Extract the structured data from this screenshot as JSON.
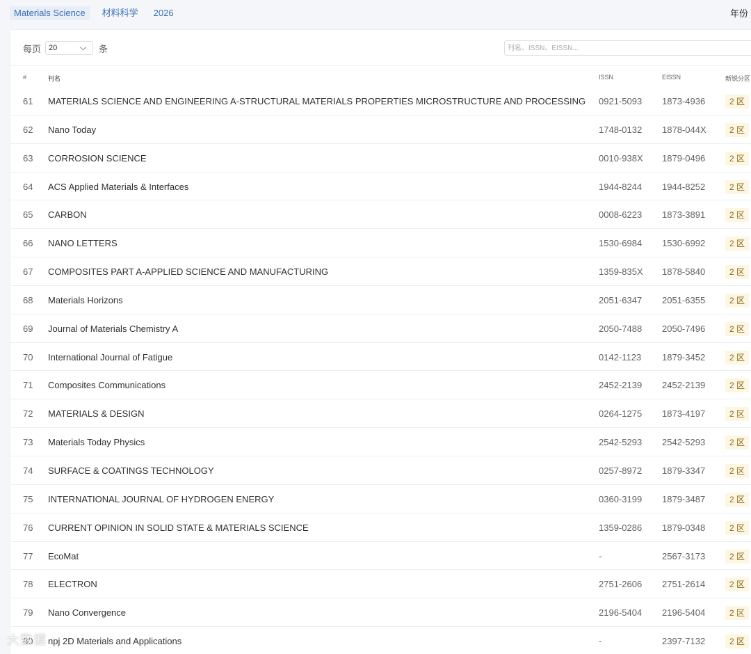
{
  "tags": [
    "Materials Science",
    "材料科学",
    "2026"
  ],
  "year_label": "年份",
  "toolbar": {
    "per_page_prefix": "每页",
    "per_page_value": "20",
    "per_page_suffix": "条",
    "search_placeholder": "刊名、ISSN、EISSN..."
  },
  "table": {
    "headers": {
      "num": "#",
      "name": "刊名",
      "issn": "ISSN",
      "eissn": "EISSN",
      "zone": "新锐分区"
    },
    "rows": [
      {
        "num": "61",
        "name": "MATERIALS SCIENCE AND ENGINEERING A-STRUCTURAL MATERIALS PROPERTIES MICROSTRUCTURE AND PROCESSING",
        "issn": "0921-5093",
        "eissn": "1873-4936",
        "zone": "2 区"
      },
      {
        "num": "62",
        "name": "Nano Today",
        "issn": "1748-0132",
        "eissn": "1878-044X",
        "zone": "2 区"
      },
      {
        "num": "63",
        "name": "CORROSION SCIENCE",
        "issn": "0010-938X",
        "eissn": "1879-0496",
        "zone": "2 区"
      },
      {
        "num": "64",
        "name": "ACS Applied Materials & Interfaces",
        "issn": "1944-8244",
        "eissn": "1944-8252",
        "zone": "2 区"
      },
      {
        "num": "65",
        "name": "CARBON",
        "issn": "0008-6223",
        "eissn": "1873-3891",
        "zone": "2 区"
      },
      {
        "num": "66",
        "name": "NANO LETTERS",
        "issn": "1530-6984",
        "eissn": "1530-6992",
        "zone": "2 区"
      },
      {
        "num": "67",
        "name": "COMPOSITES PART A-APPLIED SCIENCE AND MANUFACTURING",
        "issn": "1359-835X",
        "eissn": "1878-5840",
        "zone": "2 区"
      },
      {
        "num": "68",
        "name": "Materials Horizons",
        "issn": "2051-6347",
        "eissn": "2051-6355",
        "zone": "2 区"
      },
      {
        "num": "69",
        "name": "Journal of Materials Chemistry A",
        "issn": "2050-7488",
        "eissn": "2050-7496",
        "zone": "2 区"
      },
      {
        "num": "70",
        "name": "International Journal of Fatigue",
        "issn": "0142-1123",
        "eissn": "1879-3452",
        "zone": "2 区"
      },
      {
        "num": "71",
        "name": "Composites Communications",
        "issn": "2452-2139",
        "eissn": "2452-2139",
        "zone": "2 区"
      },
      {
        "num": "72",
        "name": "MATERIALS & DESIGN",
        "issn": "0264-1275",
        "eissn": "1873-4197",
        "zone": "2 区"
      },
      {
        "num": "73",
        "name": "Materials Today Physics",
        "issn": "2542-5293",
        "eissn": "2542-5293",
        "zone": "2 区"
      },
      {
        "num": "74",
        "name": "SURFACE & COATINGS TECHNOLOGY",
        "issn": "0257-8972",
        "eissn": "1879-3347",
        "zone": "2 区"
      },
      {
        "num": "75",
        "name": "INTERNATIONAL JOURNAL OF HYDROGEN ENERGY",
        "issn": "0360-3199",
        "eissn": "1879-3487",
        "zone": "2 区"
      },
      {
        "num": "76",
        "name": "CURRENT OPINION IN SOLID STATE & MATERIALS SCIENCE",
        "issn": "1359-0286",
        "eissn": "1879-0348",
        "zone": "2 区"
      },
      {
        "num": "77",
        "name": "EcoMat",
        "issn": "-",
        "eissn": "2567-3173",
        "zone": "2 区"
      },
      {
        "num": "78",
        "name": "ELECTRON",
        "issn": "2751-2606",
        "eissn": "2751-2614",
        "zone": "2 区"
      },
      {
        "num": "79",
        "name": "Nano Convergence",
        "issn": "2196-5404",
        "eissn": "2196-5404",
        "zone": "2 区"
      },
      {
        "num": "80",
        "name": "npj 2D Materials and Applications",
        "issn": "-",
        "eissn": "2397-7132",
        "zone": "2 区"
      }
    ]
  },
  "watermark": "大数据"
}
